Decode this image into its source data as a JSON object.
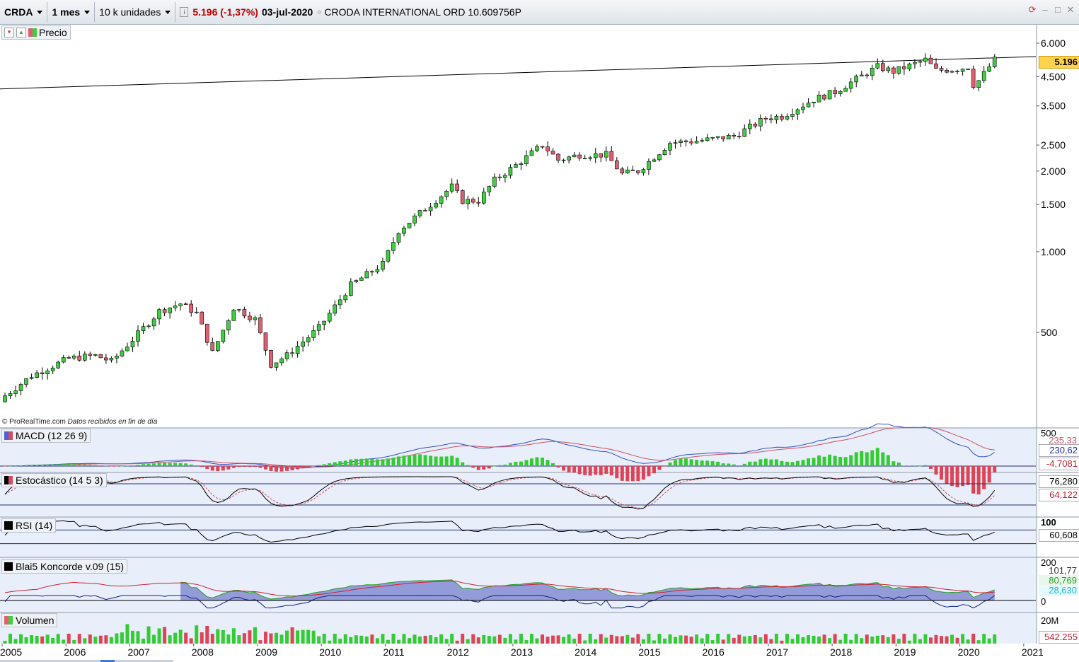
{
  "toolbar": {
    "symbol": "CRDA",
    "interval": "1 mes",
    "units": "10 k unidades",
    "price_change": "5.196 (-1,37%)",
    "date": "03-jul-2020",
    "instrument": "CRODA INTERNATIONAL ORD 10.609756P"
  },
  "credit": {
    "source": "© ProRealTime.com",
    "note": "Datos recibidos en fin de día"
  },
  "colors": {
    "up": "#3fcf3f",
    "down": "#e06070",
    "volume_up": "#33cc33",
    "volume_down": "#dd4455",
    "background": "#ffffff",
    "indicator_bg": "#e8eefa",
    "price_tag": "#ffd24d"
  },
  "chart_data": [
    {
      "type": "candlestick",
      "title": "Precio",
      "scale": "log",
      "x_ticks": [
        "2005",
        "2006",
        "2007",
        "2008",
        "2009",
        "2010",
        "2011",
        "2012",
        "2013",
        "2014",
        "2015",
        "2016",
        "2017",
        "2018",
        "2019",
        "2020",
        "2021"
      ],
      "y_ticks": [
        6000,
        4500,
        3500,
        2500,
        2000,
        1500,
        1000,
        500
      ],
      "y_tick_labels": [
        "6.000",
        "4.500",
        "3.500",
        "2.500",
        "2.000",
        "1.500",
        "1.000",
        "500"
      ],
      "last_price_label": "5.196",
      "trendline": {
        "from": [
          "2005-01",
          4000
        ],
        "to": [
          "2020-12",
          5250
        ]
      },
      "anchors": [
        [
          "2005-01",
          290
        ],
        [
          "2005-06",
          345
        ],
        [
          "2006-01",
          400
        ],
        [
          "2006-06",
          410
        ],
        [
          "2006-09",
          390
        ],
        [
          "2007-01",
          470
        ],
        [
          "2007-06",
          600
        ],
        [
          "2007-10",
          640
        ],
        [
          "2008-01",
          590
        ],
        [
          "2008-04",
          420
        ],
        [
          "2008-08",
          620
        ],
        [
          "2008-12",
          560
        ],
        [
          "2009-03",
          380
        ],
        [
          "2009-06",
          410
        ],
        [
          "2009-12",
          520
        ],
        [
          "2010-06",
          750
        ],
        [
          "2010-12",
          900
        ],
        [
          "2011-03",
          1200
        ],
        [
          "2011-09",
          1500
        ],
        [
          "2012-01",
          1750
        ],
        [
          "2012-03",
          1550
        ],
        [
          "2012-06",
          1550
        ],
        [
          "2012-09",
          1850
        ],
        [
          "2013-01",
          2100
        ],
        [
          "2013-06",
          2500
        ],
        [
          "2013-09",
          2200
        ],
        [
          "2014-01",
          2300
        ],
        [
          "2014-06",
          2300
        ],
        [
          "2014-09",
          1950
        ],
        [
          "2014-12",
          2000
        ],
        [
          "2015-06",
          2550
        ],
        [
          "2015-12",
          2600
        ],
        [
          "2016-06",
          2700
        ],
        [
          "2016-12",
          3150
        ],
        [
          "2017-03",
          3200
        ],
        [
          "2017-09",
          3700
        ],
        [
          "2018-01",
          3950
        ],
        [
          "2018-09",
          4900
        ],
        [
          "2018-12",
          4700
        ],
        [
          "2019-06",
          5200
        ],
        [
          "2019-08",
          4750
        ],
        [
          "2019-12",
          4800
        ],
        [
          "2020-02",
          4900
        ],
        [
          "2020-03",
          4200
        ],
        [
          "2020-04",
          4350
        ],
        [
          "2020-07",
          5196
        ]
      ]
    },
    {
      "type": "line",
      "title": "MACD (12 26 9)",
      "y_ticks": [
        "500"
      ],
      "values": {
        "macd": "235,33",
        "signal": "230,62",
        "histogram": "-4,7081"
      }
    },
    {
      "type": "line",
      "title": "Estocástico (14 5 3)",
      "values": {
        "k": "76,280",
        "d": "64,122"
      }
    },
    {
      "type": "line",
      "title": "RSI (14)",
      "y_ticks": [
        "100"
      ],
      "values": {
        "rsi": "60,608"
      }
    },
    {
      "type": "area",
      "title": "Blai5 Koncorde v.09 (15)",
      "y_ticks": [
        "200",
        "0"
      ],
      "values": {
        "a": "101,77",
        "b": "80,769",
        "c": "28,630"
      }
    },
    {
      "type": "bar",
      "title": "Volumen",
      "y_ticks": [
        "20M"
      ],
      "values": {
        "last": "542.255"
      }
    }
  ]
}
